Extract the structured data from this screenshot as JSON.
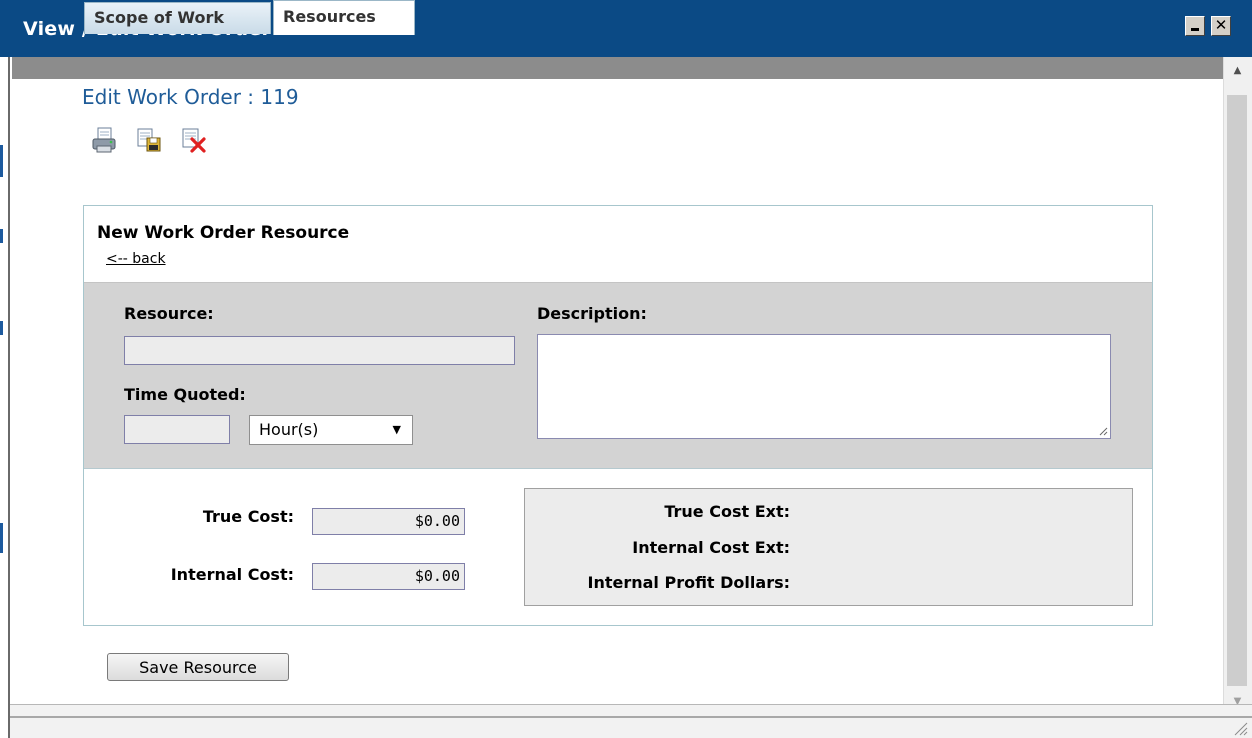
{
  "window": {
    "title": "View / Edit Work Order",
    "minimize_label": "",
    "close_label": "✕"
  },
  "page": {
    "title": "Edit Work Order : 119",
    "toolbar_icons": [
      "print-icon",
      "save-icon",
      "delete-icon"
    ]
  },
  "tabs": [
    {
      "label": "Scope of Work",
      "active": false
    },
    {
      "label": "Resources",
      "active": true
    }
  ],
  "section": {
    "title": "New Work Order Resource",
    "back_link": "<-- back"
  },
  "form": {
    "resource_label": "Resource:",
    "resource_value": "",
    "description_label": "Description:",
    "description_value": "",
    "time_quoted_label": "Time Quoted:",
    "time_quoted_value": "",
    "time_unit": "Hour(s)",
    "true_cost_label": "True Cost:",
    "true_cost_value": "$0.00",
    "internal_cost_label": "Internal Cost:",
    "internal_cost_value": "$0.00"
  },
  "extensions": {
    "true_cost_ext_label": "True Cost Ext:",
    "internal_cost_ext_label": "Internal Cost Ext:",
    "internal_profit_label": "Internal Profit Dollars:"
  },
  "actions": {
    "save_label": "Save Resource"
  },
  "colors": {
    "titlebar": "#0b4a85",
    "page_title": "#1f5c98",
    "panel_border": "#a7c6cd",
    "gray_box": "#d3d3d3"
  }
}
